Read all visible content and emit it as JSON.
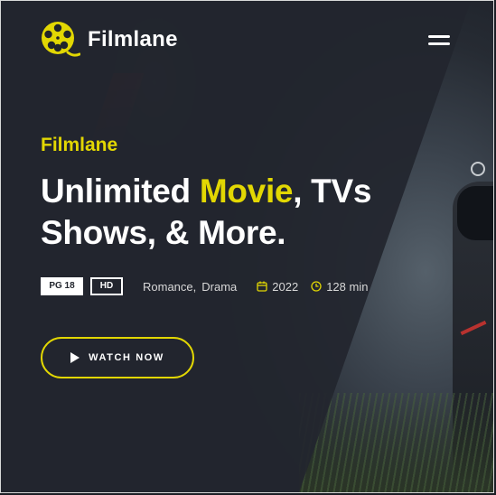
{
  "header": {
    "brand": "Filmlane",
    "logo_icon": "film-reel-icon",
    "menu_icon": "hamburger-menu-icon"
  },
  "hero": {
    "subtitle": "Filmlane",
    "title_part1": "Unlimited ",
    "title_accent": "Movie",
    "title_part2": ", TVs",
    "title_line2": "Shows, & More.",
    "badges": [
      "PG 18",
      "HD"
    ],
    "genres": [
      "Romance,",
      "Drama"
    ],
    "release_year": "2022",
    "duration": "128 min",
    "cta_label": "WATCH NOW"
  },
  "colors": {
    "accent": "#e2d703",
    "background": "#22262e",
    "text": "#ffffff"
  }
}
